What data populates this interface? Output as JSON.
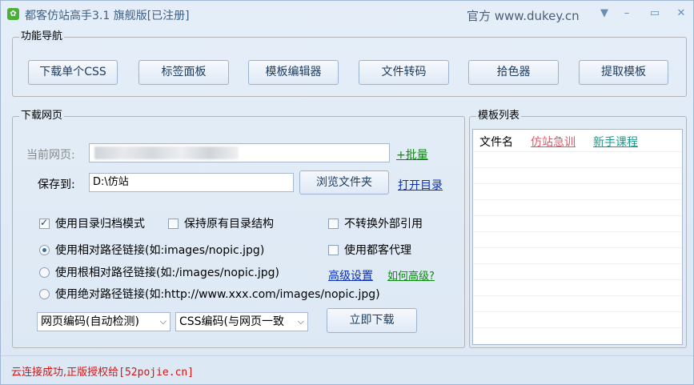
{
  "window": {
    "title": "都客仿站高手3.1 旗舰版[已注册]",
    "site": "官方 www.dukey.cn",
    "icon": "app-leaf-icon",
    "controls": {
      "menu": "▼",
      "minimize": "–",
      "maximize": "▭",
      "close": "✕"
    }
  },
  "nav": {
    "group_title": "功能导航",
    "buttons": [
      "下载单个CSS",
      "标签面板",
      "模板编辑器",
      "文件转码",
      "拾色器",
      "提取模板"
    ]
  },
  "download": {
    "group_title": "下载网页",
    "current_page_label": "当前网页:",
    "current_page_value": "",
    "batch_link": "+批量",
    "save_label": "保存到:",
    "save_value": "D:\\仿站",
    "browse_button": "浏览文件夹",
    "open_dir_link": "打开目录",
    "options": {
      "archive_mode": {
        "label": "使用目录归档模式",
        "checked": true
      },
      "keep_structure": {
        "label": "保持原有目录结构",
        "checked": false
      },
      "no_convert_external": {
        "label": "不转换外部引用",
        "checked": false
      },
      "use_proxy": {
        "label": "使用都客代理",
        "checked": false
      }
    },
    "path_modes": [
      {
        "label": "使用相对路径链接(如:images/nopic.jpg)",
        "selected": true
      },
      {
        "label": "使用根相对路径链接(如:/images/nopic.jpg)",
        "selected": false
      },
      {
        "label": "使用绝对路径链接(如:http://www.xxx.com/images/nopic.jpg)",
        "selected": false
      }
    ],
    "advanced_link": "高级设置",
    "how_advanced_link": "如何高级?",
    "page_encoding": "网页编码(自动检测)",
    "css_encoding": "CSS编码(与网页一致",
    "download_button": "立即下载"
  },
  "templates": {
    "group_title": "模板列表",
    "header": "文件名",
    "links": [
      "仿站急训",
      "新手课程"
    ]
  },
  "status": {
    "text_prefix": "云连接成功,正版授权给",
    "text_code": "[52pojie.cn]",
    "color": "#d41414"
  }
}
